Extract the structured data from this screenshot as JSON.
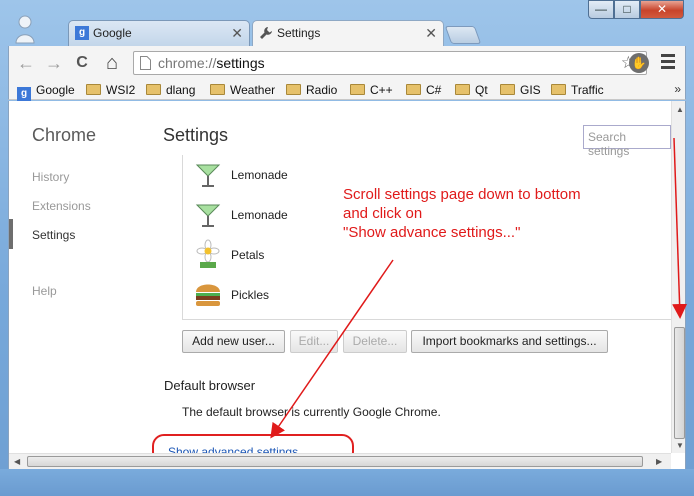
{
  "window": {
    "min_glyph": "—",
    "max_glyph": "□",
    "close_glyph": "✕"
  },
  "tabs": [
    {
      "label": "Google",
      "icon": "google-favicon",
      "close": "✕"
    },
    {
      "label": "Settings",
      "icon": "wrench-icon",
      "close": "✕"
    }
  ],
  "toolbar": {
    "back": "←",
    "forward": "→",
    "reload": "C",
    "home": "⌂",
    "url_scheme": "chrome://",
    "url_path": "settings",
    "star": "☆",
    "ext": "✋"
  },
  "bookmarks": {
    "items": [
      {
        "label": "Google",
        "icon": "google-icon"
      },
      {
        "label": "WSI2",
        "icon": "folder-icon"
      },
      {
        "label": "dlang",
        "icon": "folder-icon"
      },
      {
        "label": "Weather",
        "icon": "folder-icon"
      },
      {
        "label": "Radio",
        "icon": "folder-icon"
      },
      {
        "label": "C++",
        "icon": "folder-icon"
      },
      {
        "label": "C#",
        "icon": "folder-icon"
      },
      {
        "label": "Qt",
        "icon": "folder-icon"
      },
      {
        "label": "GIS",
        "icon": "folder-icon"
      },
      {
        "label": "Traffic",
        "icon": "folder-icon"
      }
    ],
    "overflow": "»",
    "google_glyph": "g"
  },
  "sidebar": {
    "title": "Chrome",
    "items": [
      {
        "label": "History"
      },
      {
        "label": "Extensions"
      },
      {
        "label": "Settings"
      },
      {
        "label": "Help"
      }
    ]
  },
  "main": {
    "title": "Settings",
    "search_placeholder": "Search settings",
    "users": [
      {
        "name": "Lemonade",
        "avatar": "cocktail-avatar"
      },
      {
        "name": "Lemonade",
        "avatar": "cocktail-avatar"
      },
      {
        "name": "Petals",
        "avatar": "daisy-avatar"
      },
      {
        "name": "Pickles",
        "avatar": "burger-avatar"
      }
    ],
    "buttons": {
      "add": "Add new user...",
      "edit": "Edit...",
      "delete": "Delete...",
      "import": "Import bookmarks and settings..."
    },
    "default_browser": {
      "title": "Default browser",
      "text": "The default browser is currently Google Chrome."
    },
    "advanced_link": "Show advanced settings..."
  },
  "annotation": {
    "text": "Scroll settings page down to bottom\nand click on\n\"Show advance settings...\"",
    "color": "#e01a1a"
  }
}
